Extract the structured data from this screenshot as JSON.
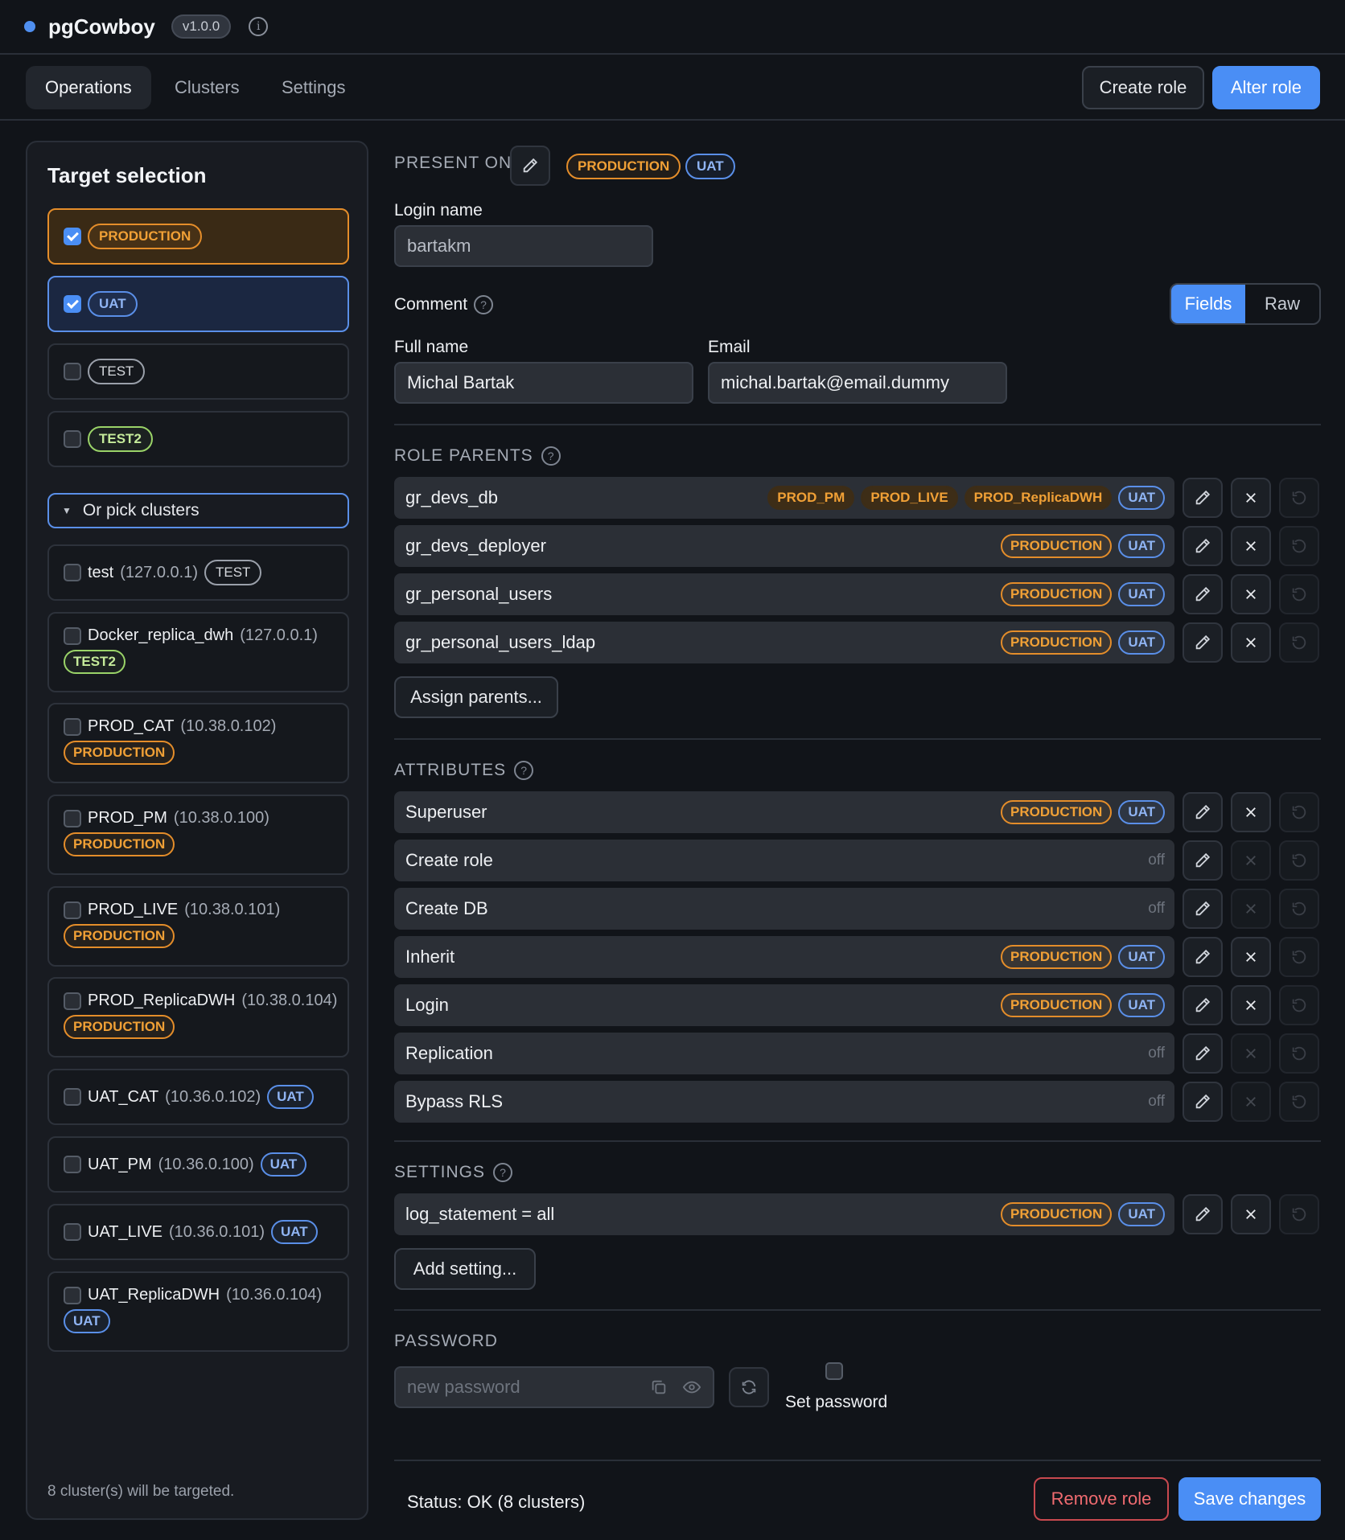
{
  "app": {
    "name": "pgCowboy",
    "version": "v1.0.0"
  },
  "nav": {
    "tabs": [
      "Operations",
      "Clusters",
      "Settings"
    ],
    "create_role": "Create role",
    "alter_role": "Alter role"
  },
  "sidebar": {
    "title": "Target selection",
    "targets": [
      {
        "label": "PRODUCTION",
        "checked": true
      },
      {
        "label": "UAT",
        "checked": true
      },
      {
        "label": "TEST",
        "checked": false
      },
      {
        "label": "TEST2",
        "checked": false
      }
    ],
    "pick_clusters": "Or pick clusters",
    "clusters": [
      {
        "name": "test",
        "ip": "(127.0.0.1)",
        "env": "TEST"
      },
      {
        "name": "Docker_replica_dwh",
        "ip": "(127.0.0.1)",
        "env": "TEST2"
      },
      {
        "name": "PROD_CAT",
        "ip": "(10.38.0.102)",
        "env": "PRODUCTION"
      },
      {
        "name": "PROD_PM",
        "ip": "(10.38.0.100)",
        "env": "PRODUCTION"
      },
      {
        "name": "PROD_LIVE",
        "ip": "(10.38.0.101)",
        "env": "PRODUCTION"
      },
      {
        "name": "PROD_ReplicaDWH",
        "ip": "(10.38.0.104)",
        "env": "PRODUCTION"
      },
      {
        "name": "UAT_CAT",
        "ip": "(10.36.0.102)",
        "env": "UAT"
      },
      {
        "name": "UAT_PM",
        "ip": "(10.36.0.100)",
        "env": "UAT"
      },
      {
        "name": "UAT_LIVE",
        "ip": "(10.36.0.101)",
        "env": "UAT"
      },
      {
        "name": "UAT_ReplicaDWH",
        "ip": "(10.36.0.104)",
        "env": "UAT"
      }
    ],
    "footer": "8 cluster(s) will be targeted."
  },
  "main": {
    "present_on_label": "PRESENT ON",
    "present_on_tags": [
      "PRODUCTION",
      "UAT"
    ],
    "login_name_label": "Login name",
    "login_name_value": "bartakm",
    "comment_label": "Comment",
    "view_toggle": {
      "fields": "Fields",
      "raw": "Raw"
    },
    "full_name_label": "Full name",
    "full_name_value": "Michal Bartak",
    "email_label": "Email",
    "email_value": "michal.bartak@email.dummy",
    "role_parents_label": "ROLE PARENTS",
    "role_parents": [
      {
        "name": "gr_devs_db",
        "tags": [
          "PROD_PM",
          "PROD_LIVE",
          "PROD_ReplicaDWH"
        ],
        "uat": "UAT"
      },
      {
        "name": "gr_devs_deployer",
        "tags": [
          "PRODUCTION"
        ],
        "uat": "UAT"
      },
      {
        "name": "gr_personal_users",
        "tags": [
          "PRODUCTION"
        ],
        "uat": "UAT"
      },
      {
        "name": "gr_personal_users_ldap",
        "tags": [
          "PRODUCTION"
        ],
        "uat": "UAT"
      }
    ],
    "assign_parents": "Assign parents...",
    "attributes_label": "ATTRIBUTES",
    "attributes": [
      {
        "name": "Superuser",
        "state": "tags"
      },
      {
        "name": "Create role",
        "state": "off"
      },
      {
        "name": "Create DB",
        "state": "off"
      },
      {
        "name": "Inherit",
        "state": "tags"
      },
      {
        "name": "Login",
        "state": "tags"
      },
      {
        "name": "Replication",
        "state": "off"
      },
      {
        "name": "Bypass RLS",
        "state": "off"
      }
    ],
    "off_text": "off",
    "tag_production": "PRODUCTION",
    "tag_uat": "UAT",
    "settings_label": "SETTINGS",
    "settings": [
      {
        "name": "log_statement = all"
      }
    ],
    "add_setting": "Add setting...",
    "password_label": "PASSWORD",
    "password_placeholder": "new password",
    "set_password_label": "Set password",
    "status": "Status: OK (8 clusters)",
    "remove_role": "Remove role",
    "save_changes": "Save changes"
  },
  "colors": {
    "accent": "#4a8ef5",
    "production": "#e48d2a",
    "uat": "#5a8fe8",
    "test2": "#9ad368",
    "danger": "#c8494f",
    "background": "#111419"
  }
}
